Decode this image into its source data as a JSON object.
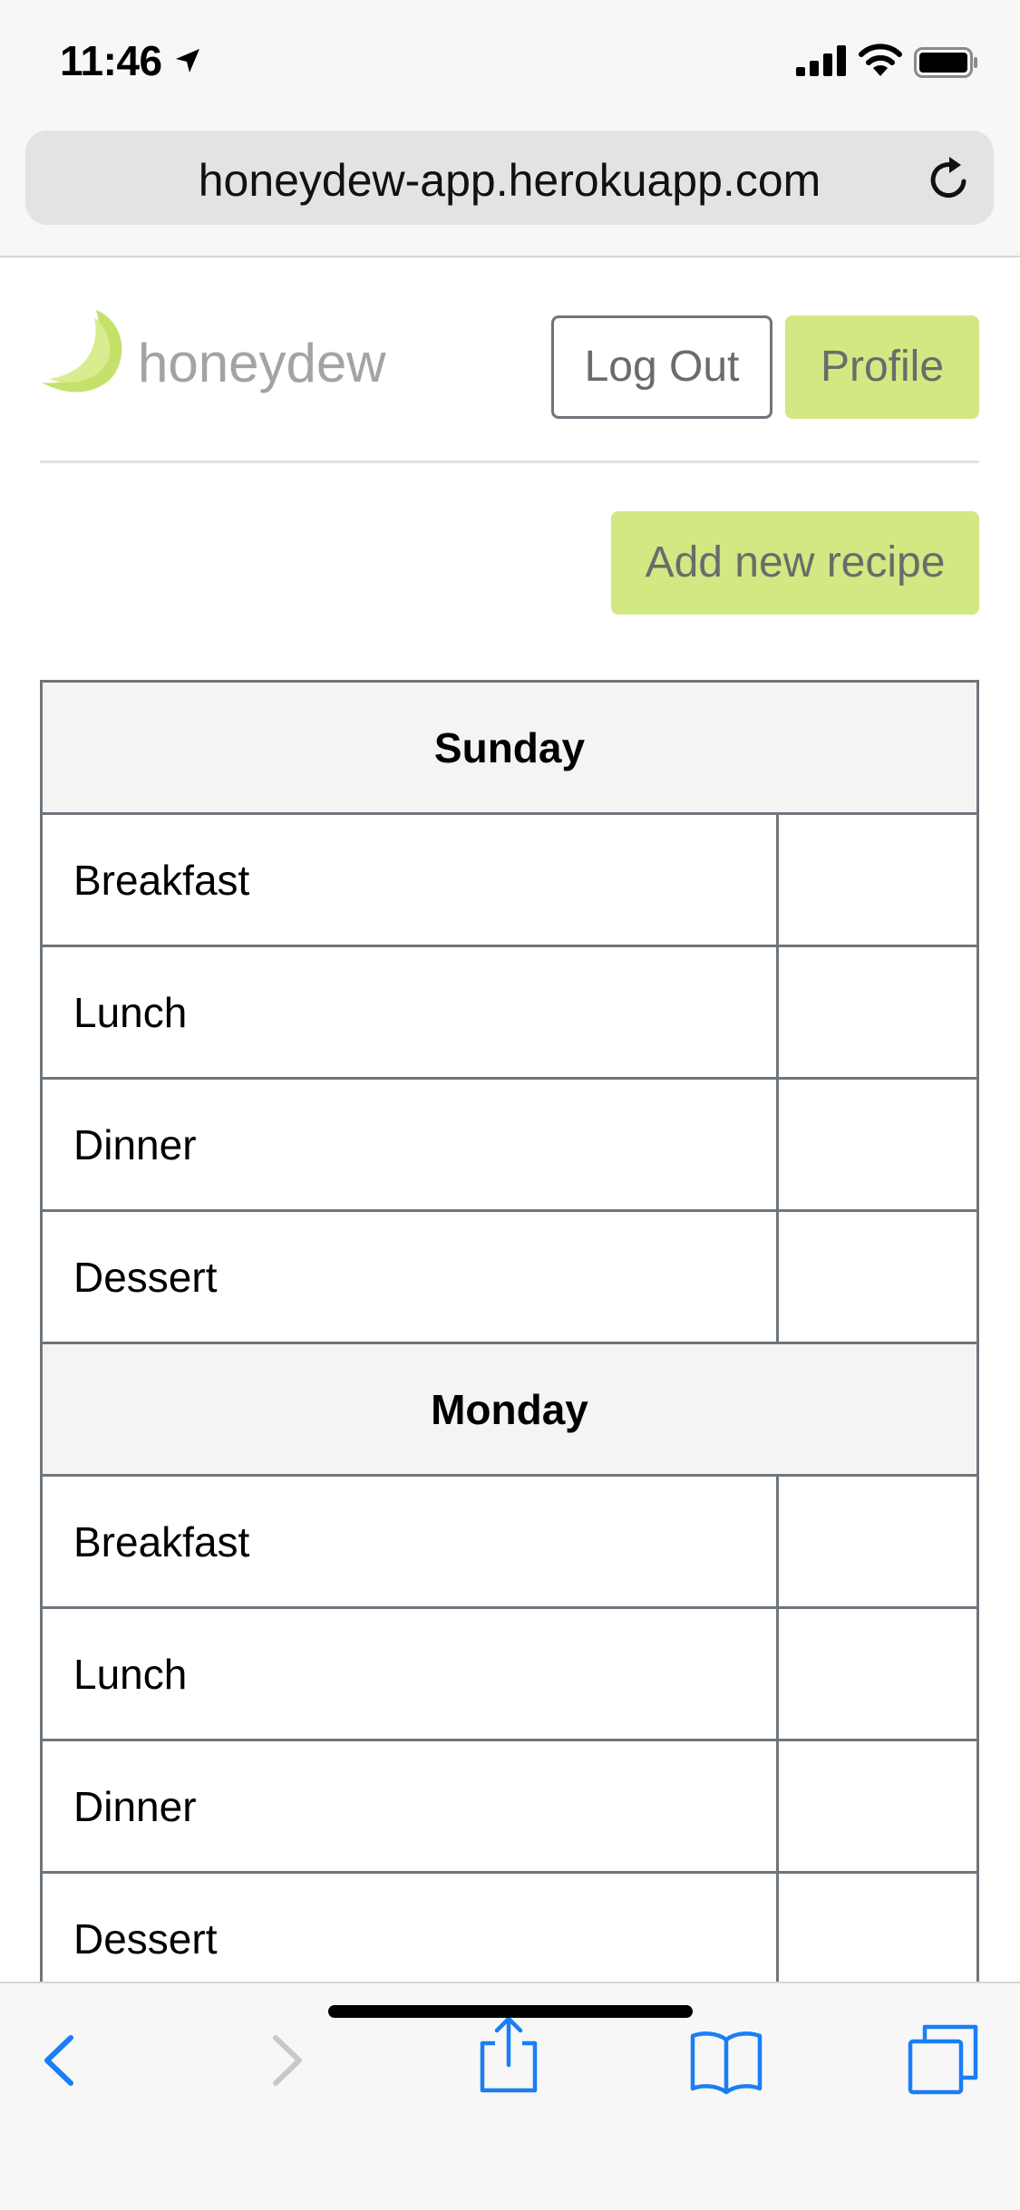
{
  "status_bar": {
    "time": "11:46",
    "icons": [
      "location-arrow-icon",
      "cellular-signal-icon",
      "wifi-icon",
      "battery-icon"
    ]
  },
  "browser": {
    "url": "honeydew-app.herokuapp.com",
    "reload_icon": "reload-icon",
    "toolbar_icons": [
      "back-icon",
      "forward-icon",
      "share-icon",
      "bookmarks-icon",
      "tabs-icon"
    ]
  },
  "header": {
    "brand": "honeydew",
    "logo_icon": "honeydew-melon-icon",
    "logout_label": "Log Out",
    "profile_label": "Profile"
  },
  "actions": {
    "add_recipe_label": "Add new recipe"
  },
  "planner": {
    "days": [
      {
        "name": "Sunday",
        "meals": [
          "Breakfast",
          "Lunch",
          "Dinner",
          "Dessert"
        ]
      },
      {
        "name": "Monday",
        "meals": [
          "Breakfast",
          "Lunch",
          "Dinner",
          "Dessert"
        ]
      }
    ]
  },
  "colors": {
    "accent": "#d2e882",
    "border": "#6e757c",
    "ios_blue": "#1a7ef5"
  }
}
